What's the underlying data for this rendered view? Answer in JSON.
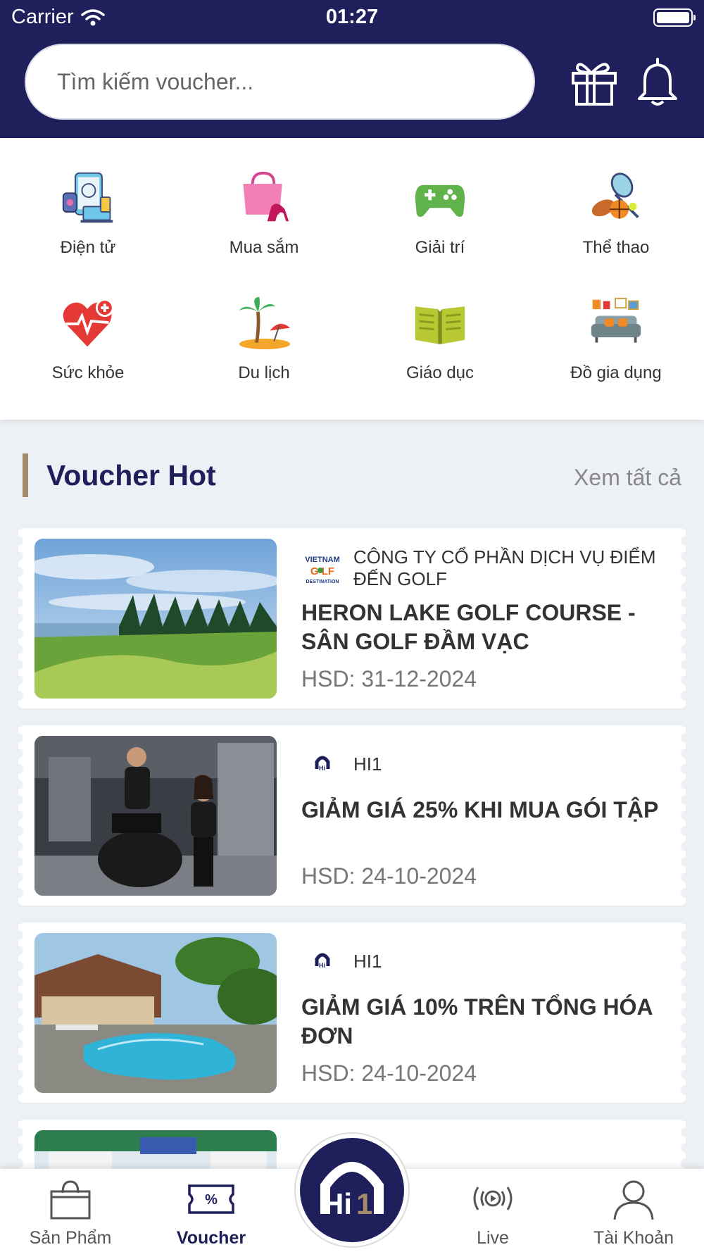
{
  "status_bar": {
    "carrier": "Carrier",
    "time": "01:27"
  },
  "search": {
    "placeholder": "Tìm kiếm voucher..."
  },
  "header_icons": [
    "gift-icon",
    "bell-icon"
  ],
  "categories": [
    {
      "label": "Điện tử",
      "icon": "electronics-icon"
    },
    {
      "label": "Mua sắm",
      "icon": "shopping-bag-icon"
    },
    {
      "label": "Giải trí",
      "icon": "gamepad-icon"
    },
    {
      "label": "Thể thao",
      "icon": "sports-icon"
    },
    {
      "label": "Sức khỏe",
      "icon": "health-heart-icon"
    },
    {
      "label": "Du lịch",
      "icon": "beach-icon"
    },
    {
      "label": "Giáo dục",
      "icon": "book-icon"
    },
    {
      "label": "Đồ gia dụng",
      "icon": "sofa-icon"
    }
  ],
  "section": {
    "title": "Voucher Hot",
    "see_all": "Xem tất cả"
  },
  "vouchers": [
    {
      "brand": "CÔNG TY CỔ PHẦN DỊCH VỤ ĐIỂM ĐẾN GOLF",
      "logo_text": "VIETNAM GOLF DESTINATION",
      "title": "HERON LAKE GOLF COURSE - SÂN GOLF ĐẦM VẠC",
      "expiry": "HSD: 31-12-2024"
    },
    {
      "brand": "HI1",
      "logo_text": "Hi1",
      "title": "GIẢM GIÁ 25% KHI MUA GÓI TẬP",
      "expiry": "HSD: 24-10-2024"
    },
    {
      "brand": "HI1",
      "logo_text": "Hi1",
      "title": "GIẢM GIÁ 10% TRÊN TỔNG HÓA ĐƠN",
      "expiry": "HSD: 24-10-2024"
    }
  ],
  "bottom_nav": [
    {
      "label": "Sản Phẩm",
      "icon": "shopping-bag-icon",
      "active": false
    },
    {
      "label": "Voucher",
      "icon": "voucher-icon",
      "active": true
    },
    {
      "label": "Hi 1",
      "icon": "hi1-logo-icon",
      "active": false
    },
    {
      "label": "Live",
      "icon": "live-icon",
      "active": false
    },
    {
      "label": "Tài Khoản",
      "icon": "user-icon",
      "active": false
    }
  ]
}
